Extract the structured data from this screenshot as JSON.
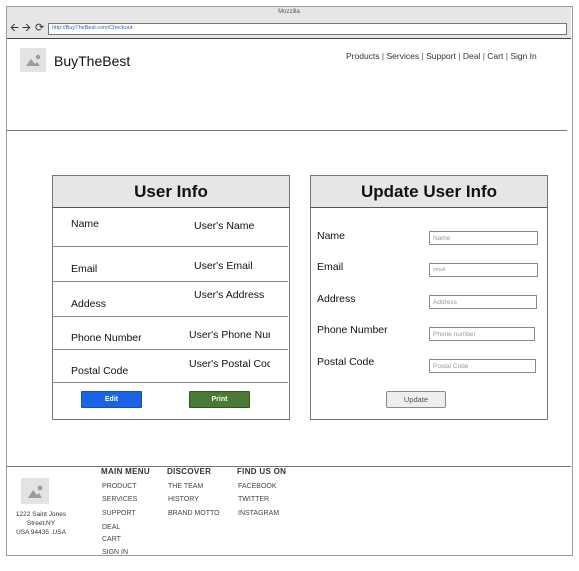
{
  "browser": {
    "window_title": "Mozzilla",
    "url": "http://BuyTheBest.com/Checkout",
    "nav_icons": [
      "back-arrow-icon",
      "forward-arrow-icon",
      "reload-icon"
    ]
  },
  "header": {
    "brand": "BuyTheBest",
    "nav": [
      "Products",
      "Services",
      "Support",
      "Deal",
      "Cart",
      "Sign In"
    ],
    "nav_separator": "|"
  },
  "user_info": {
    "title": "User Info",
    "rows": [
      {
        "label": "Name",
        "value": "User's Name"
      },
      {
        "label": "Email",
        "value": "User's Email"
      },
      {
        "label": "Addess",
        "value": "User's Address"
      },
      {
        "label": "Phone Number",
        "value": "User's Phone Number"
      },
      {
        "label": "Postal Code",
        "value": "User's Postal Code"
      }
    ],
    "edit_label": "Edit",
    "print_label": "Print"
  },
  "update_info": {
    "title": "Update User Info",
    "fields": [
      {
        "label": "Name",
        "placeholder": "Name"
      },
      {
        "label": "Email",
        "placeholder": "email"
      },
      {
        "label": "Address",
        "placeholder": "Address"
      },
      {
        "label": "Phone Number",
        "placeholder": "Phone number"
      },
      {
        "label": "Postal Code",
        "placeholder": "Postal Code"
      }
    ],
    "update_label": "Update"
  },
  "footer": {
    "address": [
      "1222 Saint Jones",
      "Street,NY",
      "USA 94435 .USA"
    ],
    "columns": [
      {
        "heading": "MAIN MENU",
        "links": [
          "PRODUCT",
          "SERVICES",
          "SUPPORT",
          "DEAL",
          "CART",
          "SIGN IN"
        ]
      },
      {
        "heading": "DISCOVER",
        "links": [
          "THE TEAM",
          "HISTORY",
          "BRAND MOTTO"
        ]
      },
      {
        "heading": "FIND US ON",
        "links": [
          "FACEBOOK",
          "TWITTER",
          "INSTAGRAM"
        ]
      }
    ]
  },
  "colors": {
    "edit_button": "#1a63e6",
    "print_button": "#4a7a35",
    "panel_header": "#e6e6e6"
  }
}
